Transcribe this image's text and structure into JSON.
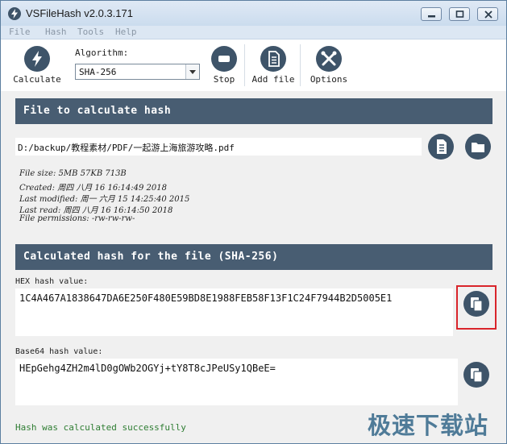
{
  "window": {
    "title": "VSFileHash v2.0.3.171"
  },
  "menu": [
    "File",
    "Hash",
    "Tools",
    "Help"
  ],
  "toolbar": {
    "calculate_label": "Calculate",
    "algorithm_label": "Algorithm:",
    "algorithm_value": "SHA-256",
    "stop_label": "Stop",
    "add_file_label": "Add file",
    "options_label": "Options"
  },
  "file_section": {
    "header": "File to calculate hash",
    "path": "D:/backup/教程素材/PDF/一起游上海旅游攻略.pdf",
    "info": [
      "File size: 5MB 57KB 713B",
      "Created: 周四 八月 16 16:14:49 2018",
      "Last modified: 周一 六月 15 14:25:40 2015",
      "Last read: 周四 八月 16 16:14:50 2018",
      "File permissions: -rw-rw-rw-"
    ]
  },
  "hash_section": {
    "header": "Calculated hash for the file (SHA-256)",
    "hex_label": "HEX hash value:",
    "hex_value": "1C4A467A1838647DA6E250F480E59BD8E1988FEB58F13F1C24F7944B2D5005E1",
    "base64_label": "Base64 hash value:",
    "base64_value": "HEpGehg4ZH2m4lD0gOWb2OGYj+tY8T8cJPeUSy1QBeE="
  },
  "status": "Hash was calculated successfully",
  "watermark": "极速下载站",
  "colors": {
    "accent": "#485d72",
    "icon_bg": "#3e5469",
    "status_green": "#2e7d32",
    "highlight": "#d9252b"
  }
}
